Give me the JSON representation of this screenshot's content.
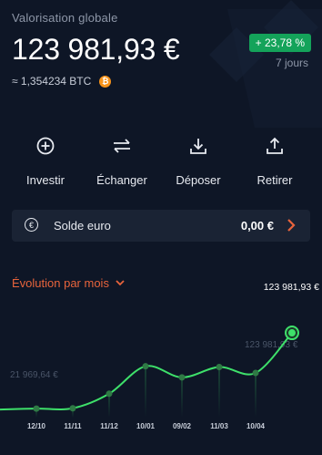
{
  "header": {
    "label": "Valorisation globale",
    "balance": "123 981,93 €",
    "btc_value": "≈ 1,354234 BTC",
    "btc_symbol": "₿",
    "change": "+ 23,78 %",
    "period": "7 jours"
  },
  "actions": [
    {
      "label": "Investir",
      "icon": "plus-circle-icon"
    },
    {
      "label": "Échanger",
      "icon": "swap-arrows-icon"
    },
    {
      "label": "Déposer",
      "icon": "download-icon"
    },
    {
      "label": "Retirer",
      "icon": "upload-icon"
    }
  ],
  "euro_balance": {
    "icon_symbol": "€",
    "label": "Solde euro",
    "value": "0,00 €"
  },
  "evolution": {
    "title": "Évolution par mois"
  },
  "colors": {
    "background": "#0e1626",
    "positive": "#14a35a",
    "accent": "#e8643c",
    "line": "#3ee06a",
    "bitcoin": "#f7931a"
  },
  "chart_data": {
    "type": "line",
    "categories": [
      "12/10",
      "11/11",
      "11/12",
      "10/01",
      "09/02",
      "11/03",
      "10/04",
      ""
    ],
    "values": [
      21969.64,
      22400,
      42000,
      79000,
      64000,
      78000,
      70000,
      123981.93
    ],
    "ylim": [
      0,
      140000
    ],
    "labels": {
      "current": "123 981,93 €",
      "start": "21 969,64 €",
      "previous": "123 981,93 €"
    },
    "grid": false
  }
}
